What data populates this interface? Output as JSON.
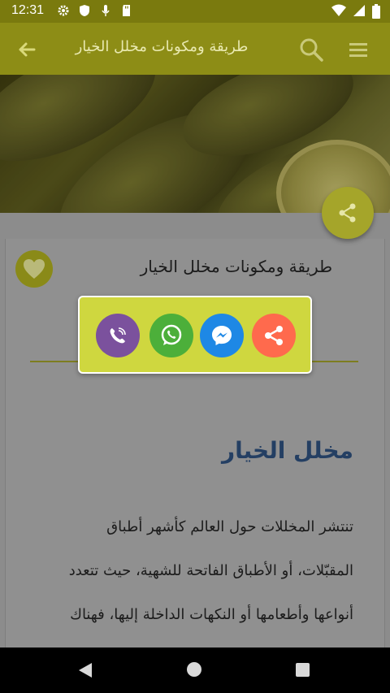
{
  "status_bar": {
    "time": "12:31",
    "left_icons": [
      "gear-icon",
      "shield-icon",
      "mic-icon",
      "sd-card-icon"
    ],
    "right_icons": [
      "wifi-icon",
      "signal-icon",
      "battery-icon"
    ]
  },
  "app_bar": {
    "title": "طريقة ومكونات مخلل الخيار",
    "back_icon": "arrow-left-icon",
    "search_icon": "search-icon",
    "menu_icon": "menu-icon"
  },
  "article": {
    "card_title": "طريقة ومكونات مخلل الخيار",
    "heading": "مخلل الخيار",
    "paragraph_lines": [
      "تنتشر المخللات حول العالم كأشهر أطباق",
      "المقبّلات، أو الأطباق الفاتحة للشهية، حيث تتعدد",
      "أنواعها وأطعامها أو النكهات الداخلة إليها، فهناك"
    ]
  },
  "share_dialog": {
    "options": [
      {
        "name": "viber",
        "color": "#7b519d"
      },
      {
        "name": "whatsapp",
        "color": "#4caf3a"
      },
      {
        "name": "messenger",
        "color": "#1e88e5"
      },
      {
        "name": "share",
        "color": "#ff6a4d"
      }
    ]
  },
  "colors": {
    "app_bar": "#8d8d16",
    "accent": "#a5a52a",
    "dialog": "#cfd73f",
    "heading": "#243f63"
  }
}
